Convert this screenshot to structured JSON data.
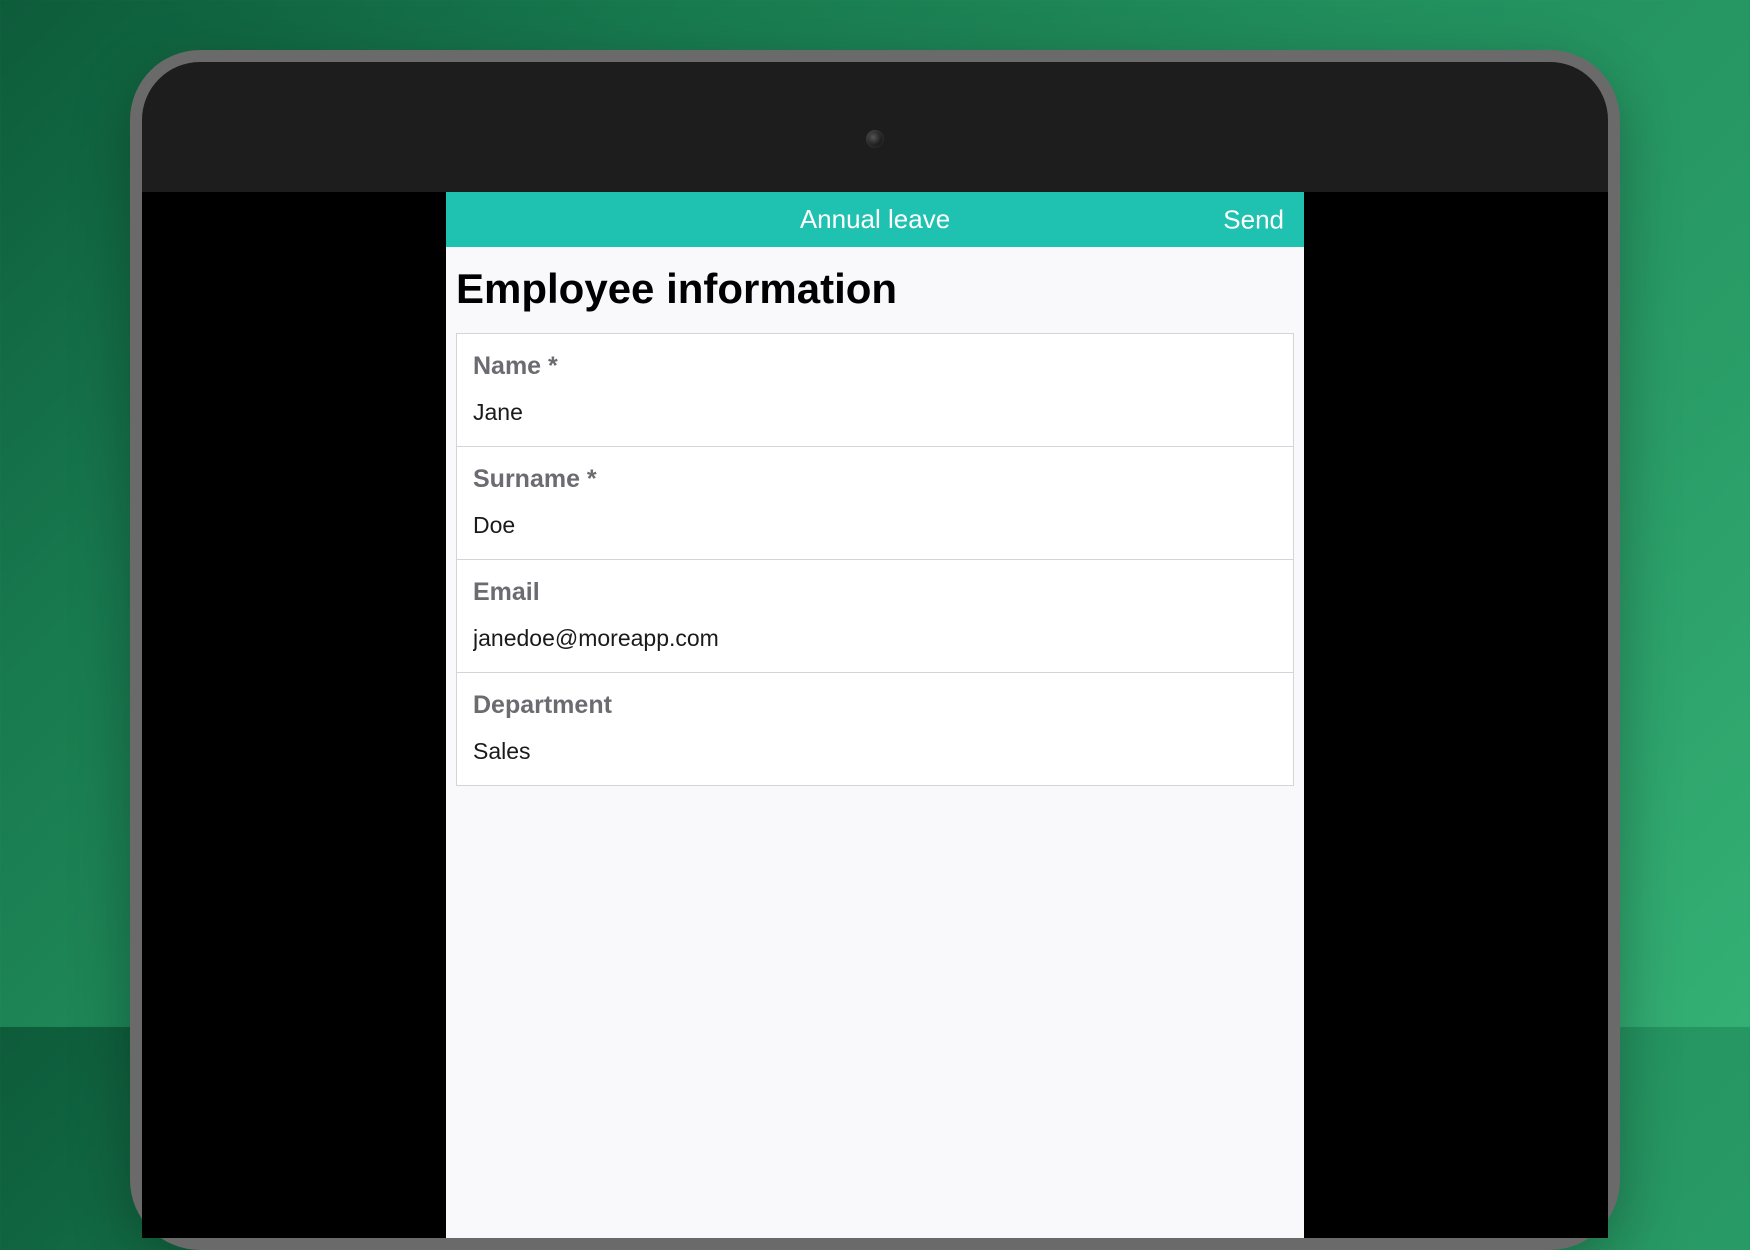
{
  "header": {
    "title": "Annual leave",
    "send_label": "Send"
  },
  "section": {
    "title": "Employee information"
  },
  "fields": {
    "name": {
      "label": "Name *",
      "value": "Jane"
    },
    "surname": {
      "label": "Surname *",
      "value": "Doe"
    },
    "email": {
      "label": "Email",
      "value": "janedoe@moreapp.com"
    },
    "department": {
      "label": "Department",
      "value": "Sales"
    }
  },
  "colors": {
    "accent": "#1fc1b1",
    "label_text": "#6b6b70"
  }
}
